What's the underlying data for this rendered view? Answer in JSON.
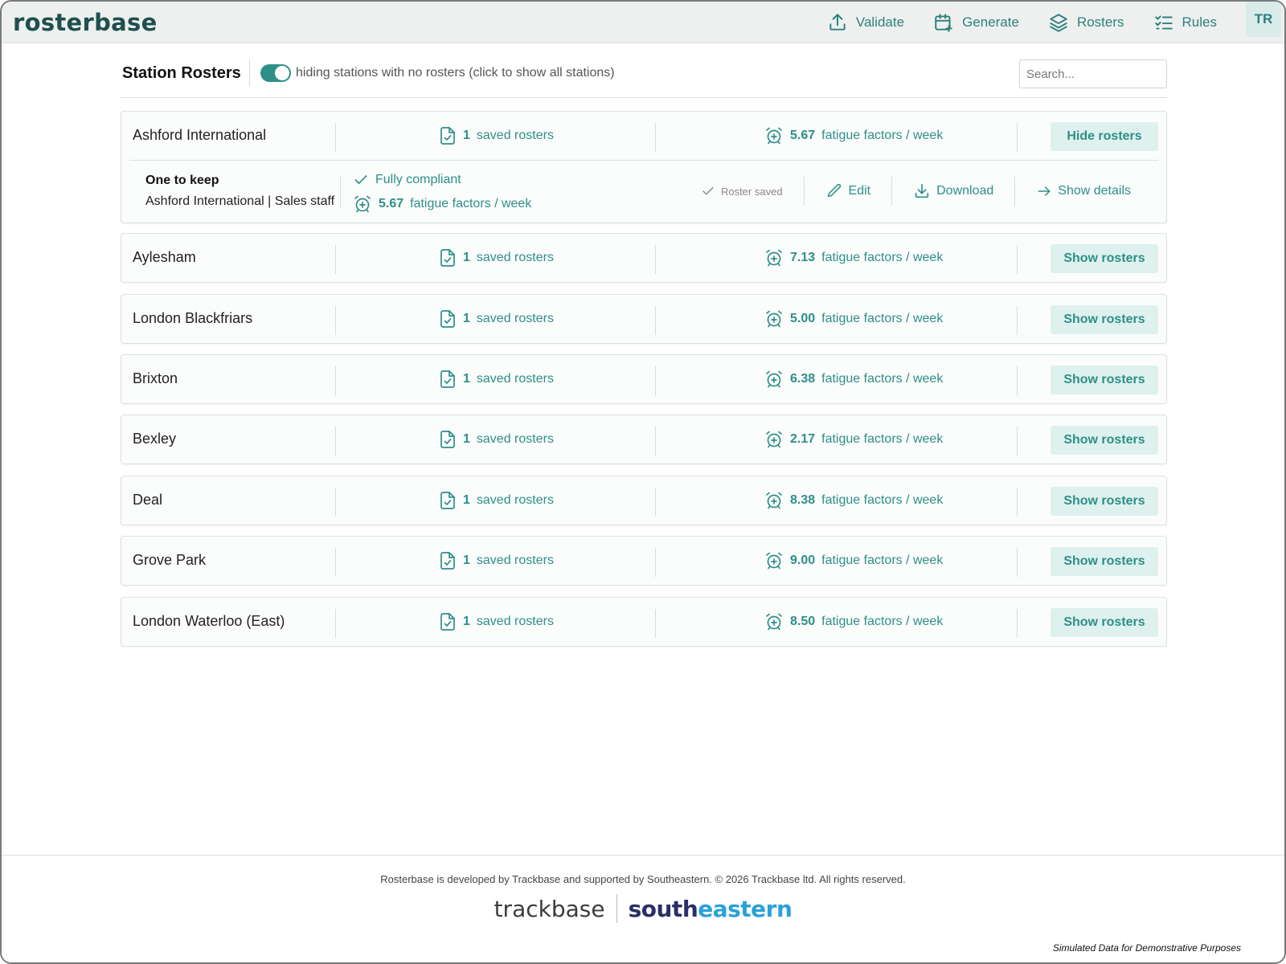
{
  "app": {
    "brand": "rosterbase",
    "avatar": "TR"
  },
  "nav": [
    {
      "label": "Validate",
      "icon": "upload-icon"
    },
    {
      "label": "Generate",
      "icon": "calendar-plus-icon"
    },
    {
      "label": "Rosters",
      "icon": "layers-icon"
    },
    {
      "label": "Rules",
      "icon": "checklist-icon"
    }
  ],
  "header": {
    "title": "Station Rosters",
    "toggle_label": "hiding stations with no rosters (click to show all stations)",
    "toggle_on": true,
    "search_placeholder": "Search..."
  },
  "stations": [
    {
      "name": "Ashford International",
      "saved_count": "1",
      "saved_label": "saved rosters",
      "fatigue": "5.67",
      "fatigue_label": "fatigue factors / week",
      "button": "Hide rosters",
      "expanded": true
    },
    {
      "name": "Aylesham",
      "saved_count": "1",
      "saved_label": "saved rosters",
      "fatigue": "7.13",
      "fatigue_label": "fatigue factors / week",
      "button": "Show rosters"
    },
    {
      "name": "London Blackfriars",
      "saved_count": "1",
      "saved_label": "saved rosters",
      "fatigue": "5.00",
      "fatigue_label": "fatigue factors / week",
      "button": "Show rosters"
    },
    {
      "name": "Brixton",
      "saved_count": "1",
      "saved_label": "saved rosters",
      "fatigue": "6.38",
      "fatigue_label": "fatigue factors / week",
      "button": "Show rosters"
    },
    {
      "name": "Bexley",
      "saved_count": "1",
      "saved_label": "saved rosters",
      "fatigue": "2.17",
      "fatigue_label": "fatigue factors / week",
      "button": "Show rosters"
    },
    {
      "name": "Deal",
      "saved_count": "1",
      "saved_label": "saved rosters",
      "fatigue": "8.38",
      "fatigue_label": "fatigue factors / week",
      "button": "Show rosters"
    },
    {
      "name": "Grove Park",
      "saved_count": "1",
      "saved_label": "saved rosters",
      "fatigue": "9.00",
      "fatigue_label": "fatigue factors / week",
      "button": "Show rosters"
    },
    {
      "name": "London Waterloo (East)",
      "saved_count": "1",
      "saved_label": "saved rosters",
      "fatigue": "8.50",
      "fatigue_label": "fatigue factors / week",
      "button": "Show rosters"
    }
  ],
  "roster_detail": {
    "name": "One to keep",
    "subtitle": "Ashford International | Sales staff",
    "compliance": "Fully compliant",
    "fatigue": "5.67",
    "fatigue_label": "fatigue factors / week",
    "saved_state": "Roster saved",
    "edit": "Edit",
    "download": "Download",
    "details": "Show details"
  },
  "footer": {
    "text": "Rosterbase is developed by Trackbase and supported by Southeastern. © 2026 Trackbase ltd. All rights reserved.",
    "logo_trackbase": "trackbase",
    "logo_south_a": "south",
    "logo_south_b": "eastern",
    "disclaimer": "Simulated Data for Demonstrative Purposes"
  },
  "colors": {
    "accent": "#2e8f88",
    "brand": "#1f4f4e",
    "button_bg": "#dff1ee"
  }
}
